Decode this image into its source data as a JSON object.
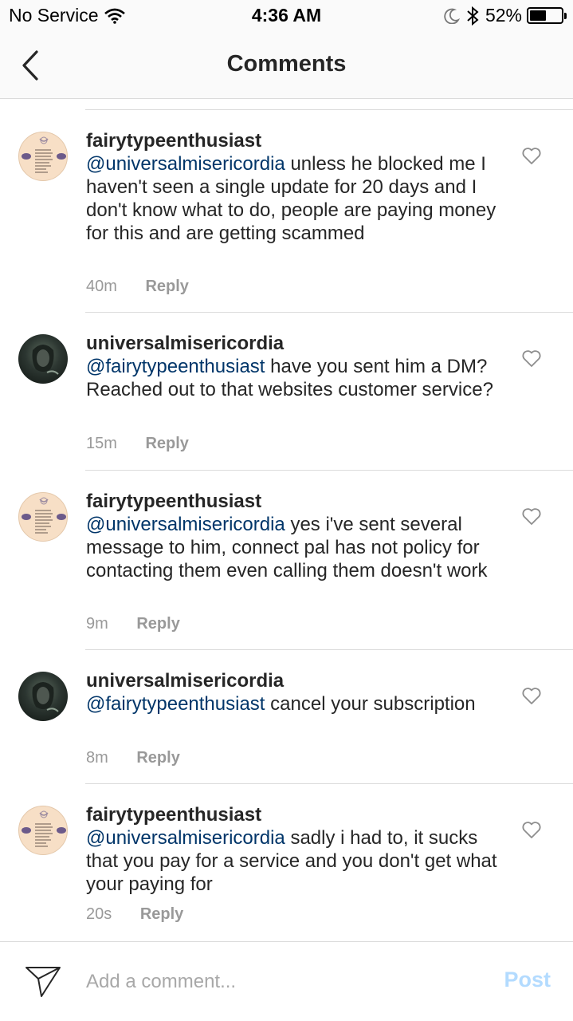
{
  "status_bar": {
    "carrier": "No Service",
    "time": "4:36 AM",
    "battery": "52%",
    "battery_level": 0.52
  },
  "nav": {
    "title": "Comments"
  },
  "comments": [
    {
      "username": "fairytypeenthusiast",
      "mention": "@universalmisericordia",
      "text": " unless he blocked me I haven't seen a single update for 20 days and I don't know what to do, people are paying money for this and are getting scammed",
      "time": "40m",
      "reply": "Reply"
    },
    {
      "username": "universalmisericordia",
      "mention": "@fairytypeenthusiast",
      "text": " have you sent him a DM? Reached out to that websites customer service?",
      "time": "15m",
      "reply": "Reply"
    },
    {
      "username": "fairytypeenthusiast",
      "mention": "@universalmisericordia",
      "text": " yes i've sent several message to him, connect pal has not policy for contacting them even calling them doesn't work",
      "time": "9m",
      "reply": "Reply"
    },
    {
      "username": "universalmisericordia",
      "mention": "@fairytypeenthusiast",
      "text": " cancel your subscription",
      "time": "8m",
      "reply": "Reply"
    },
    {
      "username": "fairytypeenthusiast",
      "mention": "@universalmisericordia",
      "text": " sadly i had to, it sucks that you pay for a service and you don't get what your paying for",
      "time": "20s",
      "reply": "Reply"
    }
  ],
  "input_bar": {
    "placeholder": "Add a comment...",
    "post_label": "Post"
  },
  "colors": {
    "mention": "#003569",
    "meta": "#999999",
    "post_disabled": "#b3dbff",
    "divider": "#dbdbdb"
  },
  "icons": {
    "back": "chevron-left-icon",
    "like": "heart-icon",
    "send": "paper-plane-icon",
    "wifi": "wifi-icon",
    "moon": "moon-icon",
    "bluetooth": "bluetooth-icon",
    "battery": "battery-icon"
  }
}
